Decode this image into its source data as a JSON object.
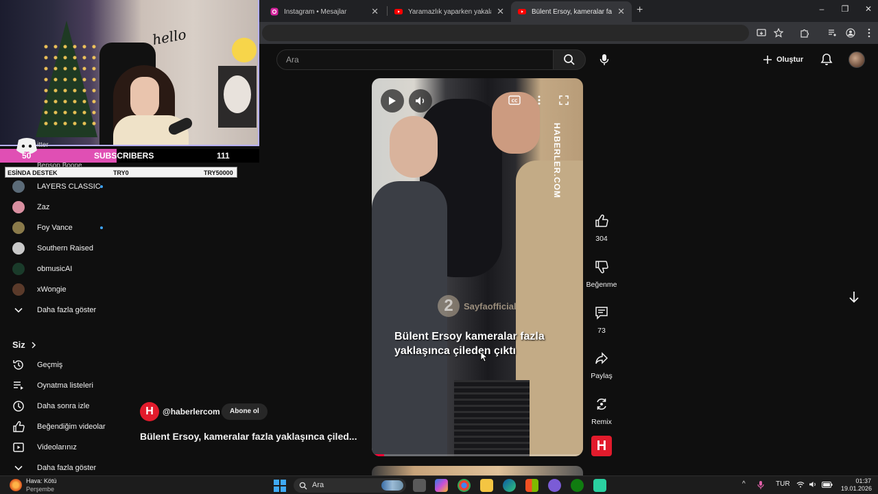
{
  "browser": {
    "tabs": [
      {
        "title": "Instagram • Mesajlar",
        "favicon": "instagram-icon"
      },
      {
        "title": "Yaramazlık yaparken yakalanan",
        "favicon": "youtube-icon"
      },
      {
        "title": "Bülent Ersoy, kameralar fazla ya",
        "favicon": "youtube-icon"
      }
    ],
    "new_tab": "+",
    "window_controls": [
      "–",
      "❐",
      "✕"
    ]
  },
  "youtube": {
    "search_placeholder": "Ara",
    "create_label": "Oluştur"
  },
  "sidebar": {
    "subscriptions": [
      {
        "name": "LAYERS CLASSIC",
        "live": true,
        "color": "#5b6b78"
      },
      {
        "name": "Zaz",
        "live": false,
        "color": "#d98fa0"
      },
      {
        "name": "Foy Vance",
        "live": true,
        "color": "#8a7a4a"
      },
      {
        "name": "Southern Raised",
        "live": false,
        "color": "#c9c9c9"
      },
      {
        "name": "obmusicAI",
        "live": false,
        "color": "#1a3b2a"
      },
      {
        "name": "xWongie",
        "live": false,
        "color": "#5a3a2a"
      }
    ],
    "show_more": "Daha fazla göster",
    "section_title": "Siz",
    "you_links": [
      {
        "label": "Geçmiş",
        "icon": "history-icon"
      },
      {
        "label": "Oynatma listeleri",
        "icon": "playlists-icon"
      },
      {
        "label": "Daha sonra izle",
        "icon": "watch-later-icon"
      },
      {
        "label": "Beğendiğim videolar",
        "icon": "liked-videos-icon"
      },
      {
        "label": "Videolarınız",
        "icon": "your-videos-icon"
      }
    ],
    "show_more_2": "Daha fazla göster"
  },
  "stream_overlay": {
    "webcam_sign": "hello",
    "subs_current": "50",
    "subs_label": "SUBSCRIBERS",
    "subs_goal": "111",
    "subs_progress": 0.45,
    "donation_label": "ESİNDA DESTEK",
    "donation_current": "TRY0",
    "donation_goal": "TRY50000",
    "behind_text_1": "itter",
    "behind_text_2": "Benson Boone"
  },
  "short": {
    "watermark": "HABERLER.COM",
    "overlay_num": "2",
    "overlay_channel": "Sayfaofficial",
    "caption": "Bülent Ersoy kameralar fazla yaklaşınca çileden çıktı",
    "progress": 0.06,
    "channel_handle": "@haberlercom",
    "channel_logo_letter": "H",
    "subscribe_label": "Abone ol",
    "title": "Bülent Ersoy, kameralar fazla yaklaşınca çiled..."
  },
  "actions": {
    "likes": "304",
    "dislike_label": "Beğenme",
    "comments": "73",
    "share_label": "Paylaş",
    "remix_label": "Remix"
  },
  "taskbar": {
    "weather_title": "Hava: Kötü",
    "weather_day": "Perşembe",
    "search_placeholder": "Ara",
    "lang": "TUR",
    "time": "01:37",
    "date": "19.01.2026"
  }
}
